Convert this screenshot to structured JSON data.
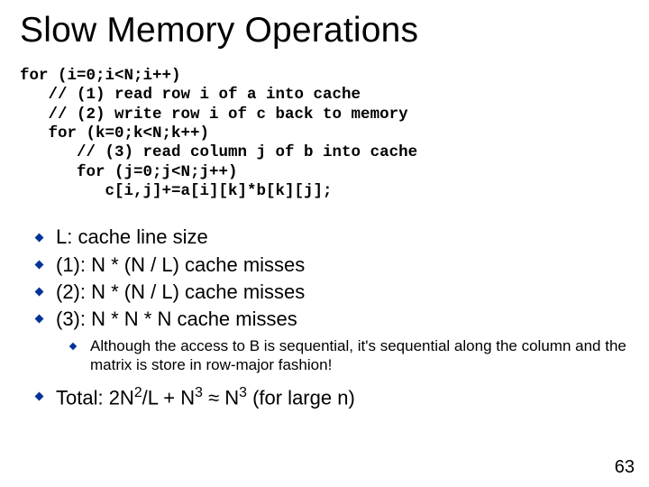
{
  "title": "Slow Memory Operations",
  "code": "for (i=0;i<N;i++)\n   // (1) read row i of a into cache\n   // (2) write row i of c back to memory\n   for (k=0;k<N;k++)\n      // (3) read column j of b into cache\n      for (j=0;j<N;j++)\n         c[i,j]+=a[i][k]*b[k][j];",
  "bullets": {
    "b1": "L: cache line size",
    "b2": "(1):  N * (N / L) cache misses",
    "b3": "(2):  N * (N / L) cache misses",
    "b4": "(3):  N * N * N cache misses",
    "sub1": "Although the access to B is sequential, it's sequential along the column and the matrix is store in row-major fashion!",
    "b5_pre": "Total: 2N",
    "b5_sup1": "2",
    "b5_mid": "/L + N",
    "b5_sup2": "3",
    "b5_approx": " ≈ N",
    "b5_sup3": "3",
    "b5_tail": "   (for large n)"
  },
  "page_number": "63"
}
